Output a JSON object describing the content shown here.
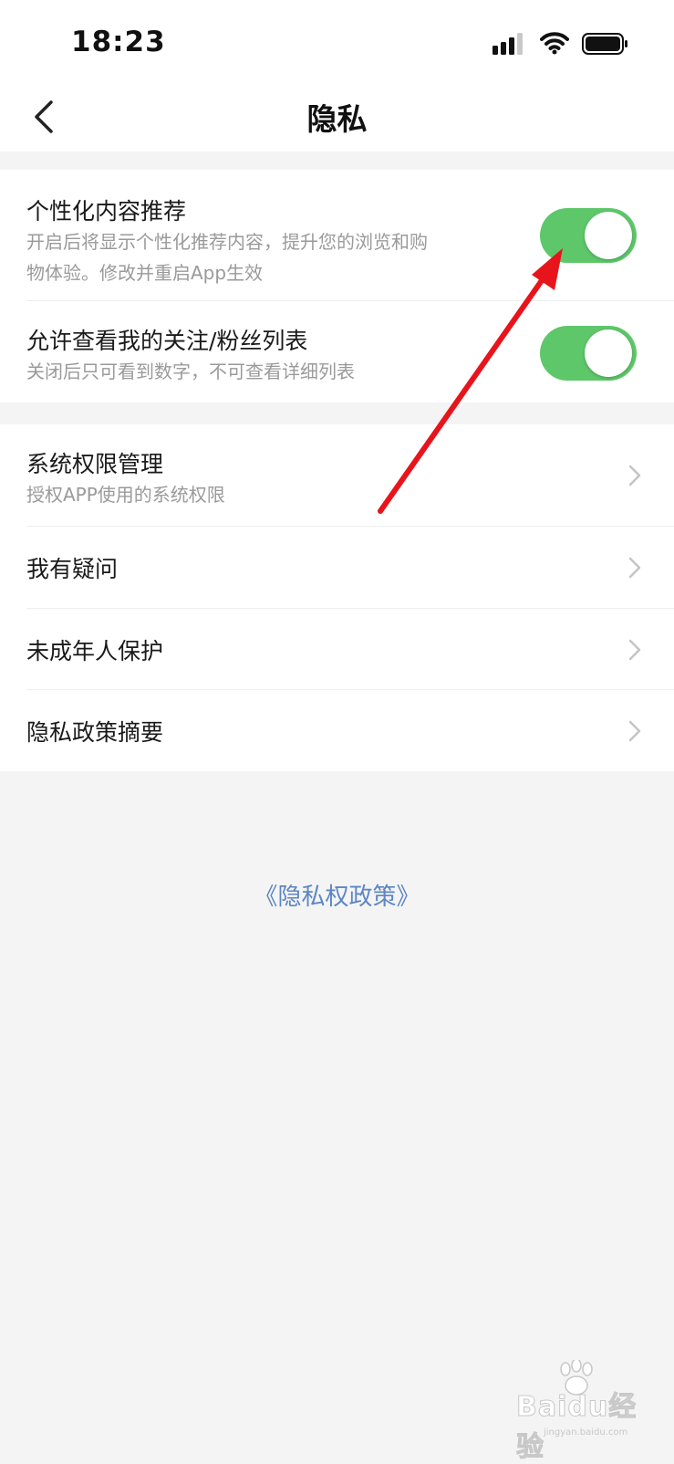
{
  "status_bar": {
    "time": "18:23",
    "signal_icon": "cellular-signal-icon",
    "wifi_icon": "wifi-icon",
    "battery_icon": "battery-icon"
  },
  "header": {
    "back_icon": "chevron-left-icon",
    "title": "隐私"
  },
  "toggles": [
    {
      "title": "个性化内容推荐",
      "desc_line1": "开启后将显示个性化推荐内容，提升您的浏览和购",
      "desc_line2": "物体验。修改并重启App生效",
      "on": true
    },
    {
      "title": "允许查看我的关注/粉丝列表",
      "desc_line1": "关闭后只可看到数字，不可查看详细列表",
      "on": true
    }
  ],
  "menu": [
    {
      "title": "系统权限管理",
      "desc": "授权APP使用的系统权限"
    },
    {
      "title": "我有疑问"
    },
    {
      "title": "未成年人保护"
    },
    {
      "title": "隐私政策摘要"
    }
  ],
  "footer": {
    "policy_link": "《隐私权政策》"
  },
  "watermark": {
    "text": "Baidu经验",
    "sub": "jingyan.baidu.com"
  },
  "colors": {
    "toggle_on": "#5ec76a",
    "link": "#5d86c4",
    "annotation_arrow": "#e8141c"
  }
}
